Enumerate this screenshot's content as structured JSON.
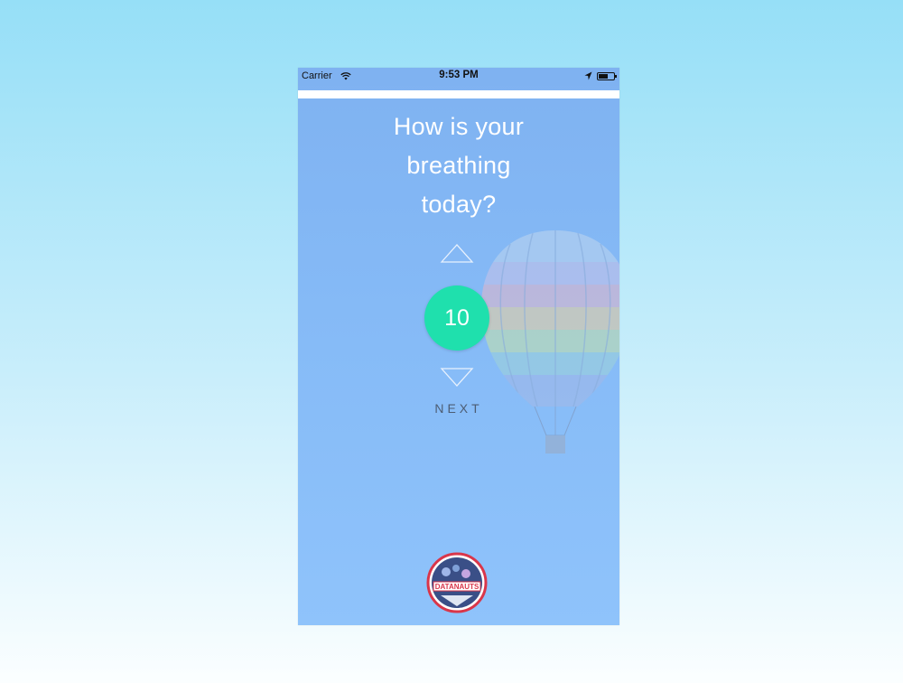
{
  "status_bar": {
    "carrier": "Carrier",
    "time": "9:53 PM"
  },
  "question": {
    "line1": "How is your",
    "line2": "breathing",
    "line3": "today?"
  },
  "rating": {
    "value": "10"
  },
  "actions": {
    "next_label": "NEXT"
  },
  "logo": {
    "text": "DATANAUTS"
  },
  "colors": {
    "background_top": "#96dff7",
    "app_background": "#86bbf7",
    "rating_accent": "#1fe0ad",
    "text_primary": "#ffffff",
    "next_text": "#4d5d73",
    "logo_ring": "#d9364a"
  },
  "icons": [
    "wifi-icon",
    "location-arrow-icon",
    "battery-icon",
    "chevron-up-icon",
    "chevron-down-icon",
    "hot-air-balloon-image",
    "datanauts-logo"
  ]
}
